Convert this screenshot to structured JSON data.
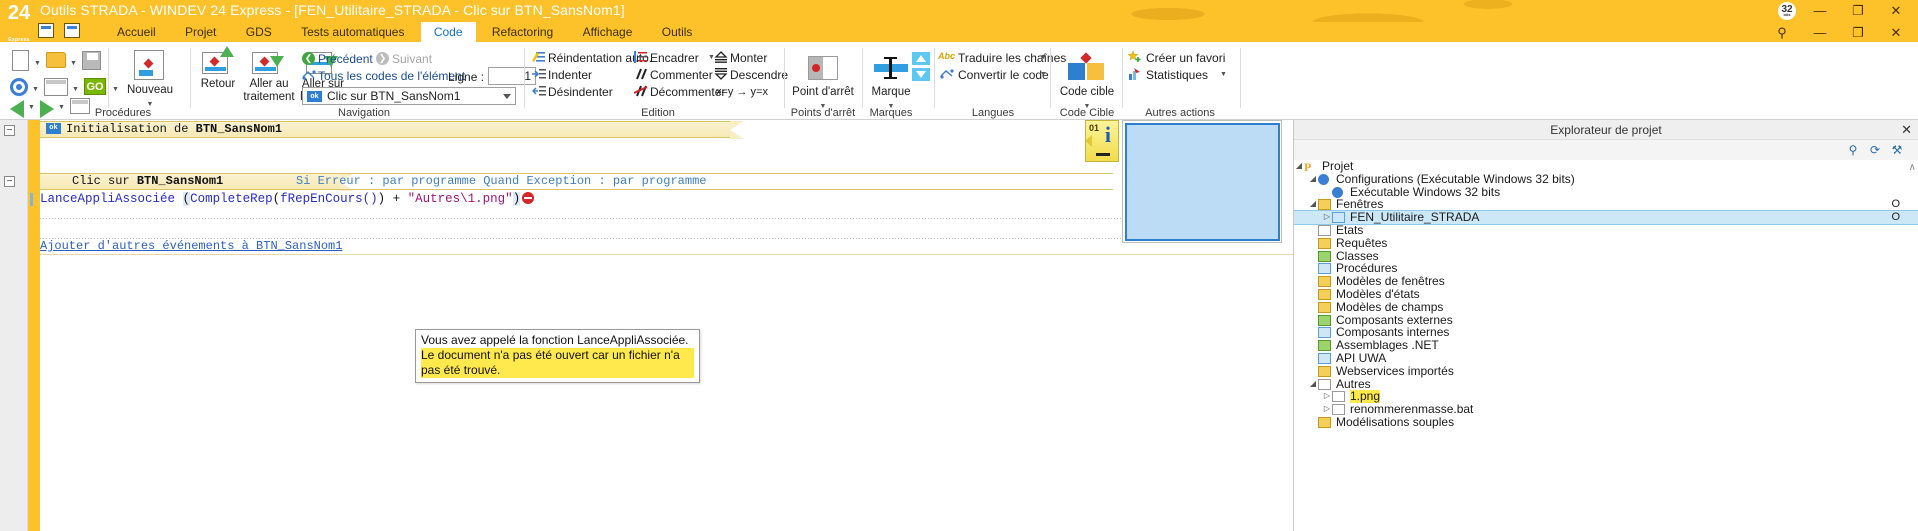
{
  "window": {
    "title": "Outils STRADA - WINDEV 24 Express - [FEN_Utilitaire_STRADA - Clic sur BTN_SansNom1]",
    "logo_main": "24",
    "logo_sub": "Express",
    "bitness_badge": "32",
    "badge_sub": "bits",
    "minimize": "—",
    "maximize": "❐",
    "close": "✕"
  },
  "menu": {
    "tabs": [
      {
        "label": "Accueil",
        "active": false
      },
      {
        "label": "Projet",
        "active": false
      },
      {
        "label": "GDS",
        "active": false
      },
      {
        "label": "Tests automatiques",
        "active": false
      },
      {
        "label": "Code",
        "active": true
      },
      {
        "label": "Refactoring",
        "active": false
      },
      {
        "label": "Affichage",
        "active": false
      },
      {
        "label": "Outils",
        "active": false
      }
    ],
    "search_icon": "⚲",
    "min": "—",
    "restore": "❐",
    "close": "✕"
  },
  "ribbon": {
    "groups": {
      "procedures": "Procédures",
      "navigation": "Navigation",
      "edition": "Edition",
      "points_arret": "Points d'arrêt",
      "marques": "Marques",
      "langues": "Langues",
      "code_cible": "Code Cible",
      "autres_actions": "Autres actions"
    },
    "nouveau": "Nouveau",
    "retour": "Retour",
    "aller_au_traitement_l1": "Aller au",
    "aller_au_traitement_l2": "traitement",
    "aller_sur_element_l1": "Aller sur",
    "aller_sur_element_l2": "l'élément",
    "precedent": "Précédent",
    "suivant": "Suivant",
    "tous_les_codes": "Tous les codes de l'élément",
    "ligne_label": "Ligne :",
    "ligne_value": "1",
    "element_combo_value": "Clic sur BTN_SansNom1",
    "element_combo_badge": "ok",
    "reindentation": "Réindentation auto.",
    "indenter": "Indenter",
    "desindenter": "Désindenter",
    "encadrer": "Encadrer",
    "commenter": "Commenter",
    "decommenter": "Décommenter",
    "monter": "Monter",
    "descendre": "Descendre",
    "swap": "x=y → y=x",
    "point_arret": "Point d'arrêt",
    "marque": "Marque",
    "traduire": "Traduire les chaînes",
    "convertir": "Convertir le code",
    "code_cible_btn": "Code cible",
    "creer_favori": "Créer un favori",
    "statistiques": "Statistiques"
  },
  "editor": {
    "event1": {
      "badge": "ok",
      "prefix": "Initialisation de ",
      "name": "BTN_SansNom1",
      "collapse": "−"
    },
    "event2": {
      "prefix": "Clic sur ",
      "name": "BTN_SansNom1",
      "collapse": "−",
      "meta": "Si Erreur : par programme   Quand Exception : par programme"
    },
    "code": {
      "fn": "LanceAppliAssociée",
      "open_paren": "(",
      "inner_fn": "CompleteRep",
      "inner_open": "(",
      "arg_fn": "fRepEnCours()",
      "inner_close": ")",
      "plus": " + ",
      "string": "\"Autres\\1.png\"",
      "close_paren": ")",
      "full_line": "LanceAppliAssociée (ComplèteRep(fRepEnCours()) + \"Autres\\1.png\")"
    },
    "add_event_link": "Ajouter d'autres événements à BTN_SansNom1",
    "tooltip": {
      "line1": "Vous avez appelé la fonction LanceAppliAssociée.",
      "line2": "Le document n'a pas été ouvert car un fichier n'a pas été trouvé."
    },
    "info_panel": {
      "number": "01",
      "glyph": "i"
    }
  },
  "explorer": {
    "title": "Explorateur de projet",
    "close": "✕",
    "toolbar": {
      "search": "⚲",
      "refresh": "⟳",
      "tools": "⚒"
    },
    "scroll_up": "∧",
    "tree": [
      {
        "label": "Projet",
        "depth": 0,
        "twisty": "◢",
        "icon": "project-icon",
        "selected": false,
        "highlight": false,
        "omark": ""
      },
      {
        "label": "Configurations (Exécutable Windows 32 bits)",
        "depth": 1,
        "twisty": "◢",
        "icon": "gear-icon",
        "selected": false,
        "highlight": false,
        "omark": ""
      },
      {
        "label": "Exécutable Windows 32 bits",
        "depth": 2,
        "twisty": "",
        "icon": "gear-icon",
        "selected": false,
        "highlight": false,
        "omark": ""
      },
      {
        "label": "Fenêtres",
        "depth": 1,
        "twisty": "◢",
        "icon": "window-folder-icon",
        "selected": false,
        "highlight": false,
        "omark": "O"
      },
      {
        "label": "FEN_Utilitaire_STRADA",
        "depth": 2,
        "twisty": "▷",
        "icon": "window-icon",
        "selected": true,
        "highlight": false,
        "omark": "O"
      },
      {
        "label": "Etats",
        "depth": 1,
        "twisty": "",
        "icon": "report-icon",
        "selected": false,
        "highlight": false,
        "omark": ""
      },
      {
        "label": "Requêtes",
        "depth": 1,
        "twisty": "",
        "icon": "query-icon",
        "selected": false,
        "highlight": false,
        "omark": ""
      },
      {
        "label": "Classes",
        "depth": 1,
        "twisty": "",
        "icon": "class-icon",
        "selected": false,
        "highlight": false,
        "omark": ""
      },
      {
        "label": "Procédures",
        "depth": 1,
        "twisty": "",
        "icon": "procedure-icon",
        "selected": false,
        "highlight": false,
        "omark": ""
      },
      {
        "label": "Modèles de fenêtres",
        "depth": 1,
        "twisty": "",
        "icon": "window-template-icon",
        "selected": false,
        "highlight": false,
        "omark": ""
      },
      {
        "label": "Modèles d'états",
        "depth": 1,
        "twisty": "",
        "icon": "report-template-icon",
        "selected": false,
        "highlight": false,
        "omark": ""
      },
      {
        "label": "Modèles de champs",
        "depth": 1,
        "twisty": "",
        "icon": "field-template-icon",
        "selected": false,
        "highlight": false,
        "omark": ""
      },
      {
        "label": "Composants externes",
        "depth": 1,
        "twisty": "",
        "icon": "external-component-icon",
        "selected": false,
        "highlight": false,
        "omark": ""
      },
      {
        "label": "Composants internes",
        "depth": 1,
        "twisty": "",
        "icon": "internal-component-icon",
        "selected": false,
        "highlight": false,
        "omark": ""
      },
      {
        "label": "Assemblages .NET",
        "depth": 1,
        "twisty": "",
        "icon": "dotnet-icon",
        "selected": false,
        "highlight": false,
        "omark": ""
      },
      {
        "label": "API UWA",
        "depth": 1,
        "twisty": "",
        "icon": "api-icon",
        "selected": false,
        "highlight": false,
        "omark": ""
      },
      {
        "label": "Webservices importés",
        "depth": 1,
        "twisty": "",
        "icon": "webservice-icon",
        "selected": false,
        "highlight": false,
        "omark": ""
      },
      {
        "label": "Autres",
        "depth": 1,
        "twisty": "◢",
        "icon": "other-icon",
        "selected": false,
        "highlight": false,
        "omark": ""
      },
      {
        "label": "1.png",
        "depth": 2,
        "twisty": "▷",
        "icon": "file-png-icon",
        "selected": false,
        "highlight": true,
        "omark": ""
      },
      {
        "label": "renommerenmasse.bat",
        "depth": 2,
        "twisty": "▷",
        "icon": "file-bat-icon",
        "selected": false,
        "highlight": false,
        "omark": ""
      },
      {
        "label": "Modélisations souples",
        "depth": 1,
        "twisty": "",
        "icon": "model-icon",
        "selected": false,
        "highlight": false,
        "omark": ""
      }
    ]
  },
  "colors": {
    "brand_gold": "#fdc12a",
    "accent_blue": "#2f7fd0",
    "error_red": "#d42626",
    "highlight_yellow": "#ffe94d",
    "selection_blue": "#cce8f7"
  }
}
